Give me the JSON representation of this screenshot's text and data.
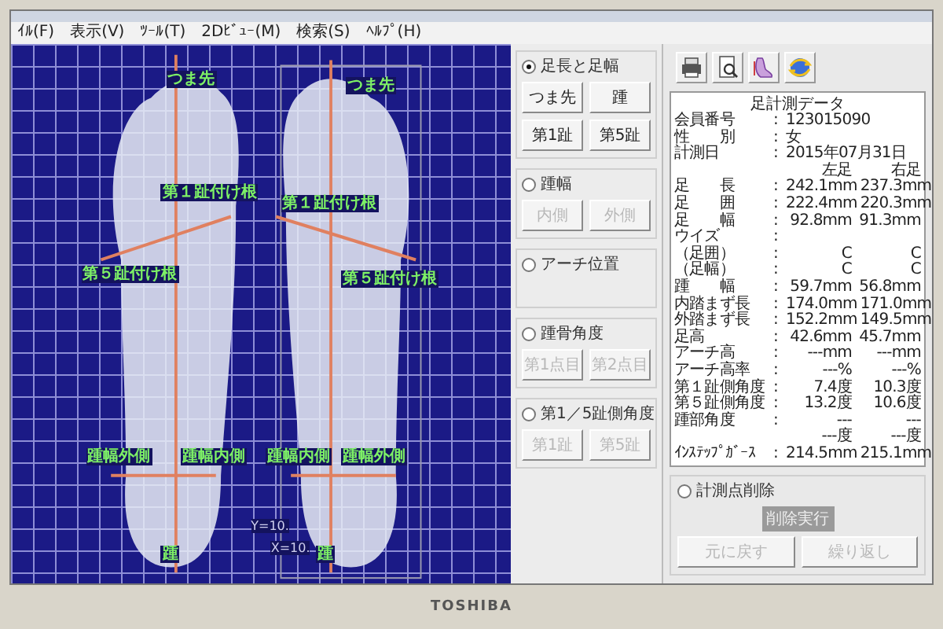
{
  "window": {
    "menu": [
      "ｲﾙ(F)",
      "表示(V)",
      "ﾂｰﾙ(T)",
      "2Dﾋﾞｭｰ(M)",
      "検索(S)",
      "ﾍﾙﾌﾟ(H)"
    ]
  },
  "canvas": {
    "feet": [
      {
        "labels": [
          "つま先",
          "第１趾付け根",
          "第５趾付け根",
          "踵幅外側",
          "踵幅内側",
          "踵"
        ]
      },
      {
        "labels": [
          "つま先",
          "第１趾付け根",
          "第５趾付け根",
          "踵幅内側",
          "踵幅外側",
          "踵"
        ]
      }
    ],
    "frame_labels": [
      "Y=10.",
      "X=10."
    ]
  },
  "controls": [
    {
      "label": "足長と足幅",
      "selected": true,
      "buttons": [
        {
          "label": "つま先",
          "disabled": false
        },
        {
          "label": "踵",
          "disabled": false
        },
        {
          "label": "第1趾",
          "disabled": false
        },
        {
          "label": "第5趾",
          "disabled": false
        }
      ]
    },
    {
      "label": "踵幅",
      "selected": false,
      "buttons": [
        {
          "label": "内側",
          "disabled": true
        },
        {
          "label": "外側",
          "disabled": true
        }
      ]
    },
    {
      "label": "アーチ位置",
      "selected": false
    },
    {
      "label": "踵骨角度",
      "selected": false,
      "buttons": [
        {
          "label": "第1点目",
          "disabled": true
        },
        {
          "label": "第2点目",
          "disabled": true
        }
      ]
    },
    {
      "label": "第1／5趾側角度",
      "selected": false,
      "buttons": [
        {
          "label": "第1趾",
          "disabled": true
        },
        {
          "label": "第5趾",
          "disabled": true
        }
      ]
    }
  ],
  "data": {
    "title": "足計測データ",
    "info": [
      {
        "label": "会員番号",
        "sep": ":",
        "value": "123015090"
      },
      {
        "label": "性　　別",
        "sep": ":",
        "value": "女"
      },
      {
        "label": "計測日",
        "sep": ":",
        "value": "2015年07月31日"
      }
    ],
    "columns": [
      "左足",
      "右足"
    ],
    "rows": [
      {
        "label": "足　　長",
        "sep": ":",
        "left": "242.1mm",
        "right": "237.3mm"
      },
      {
        "label": "足　　囲",
        "sep": ":",
        "left": "222.4mm",
        "right": "220.3mm"
      },
      {
        "label": "足　　幅",
        "sep": ":",
        "left": "92.8mm",
        "right": "91.3mm"
      },
      {
        "label": "ウイズ",
        "sep": ":"
      },
      {
        "label": "（足囲）",
        "sep": ":",
        "left": "C",
        "right": "C"
      },
      {
        "label": "（足幅）",
        "sep": ":",
        "left": "C",
        "right": "C"
      },
      {
        "label": "踵　　幅",
        "sep": ":",
        "left": "59.7mm",
        "right": "56.8mm"
      },
      {
        "label": "内踏まず長",
        "sep": ":",
        "left": "174.0mm",
        "right": "171.0mm"
      },
      {
        "label": "外踏まず長",
        "sep": ":",
        "left": "152.2mm",
        "right": "149.5mm"
      },
      {
        "label": "足高",
        "sep": ":",
        "left": "42.6mm",
        "right": "45.7mm"
      },
      {
        "label": "アーチ高",
        "sep": ":",
        "left": "---mm",
        "right": "---mm"
      },
      {
        "label": "アーチ高率",
        "sep": ":",
        "left": "---%",
        "right": "---%"
      },
      {
        "label": "第１趾側角度",
        "sep": ":",
        "left": "7.4度",
        "right": "10.3度"
      },
      {
        "label": "第５趾側角度",
        "sep": ":",
        "left": "13.2度",
        "right": "10.6度"
      },
      {
        "label": "踵部角度",
        "sep": ":",
        "left": "---",
        "right": "---"
      },
      {
        "left": "---度",
        "right": "---度"
      },
      {
        "label": "ｲﾝｽﾃｯﾌﾟｶﾞｰｽ",
        "sep": ":",
        "left": "214.5mm",
        "right": "215.1mm"
      }
    ]
  },
  "delete_group": {
    "label": "計測点削除",
    "selected": false,
    "execute": "削除実行",
    "buttons": [
      {
        "label": "元に戻す",
        "disabled": true
      },
      {
        "label": "繰り返し",
        "disabled": true
      }
    ]
  },
  "monitor": {
    "brand": "TOSHIBA"
  }
}
